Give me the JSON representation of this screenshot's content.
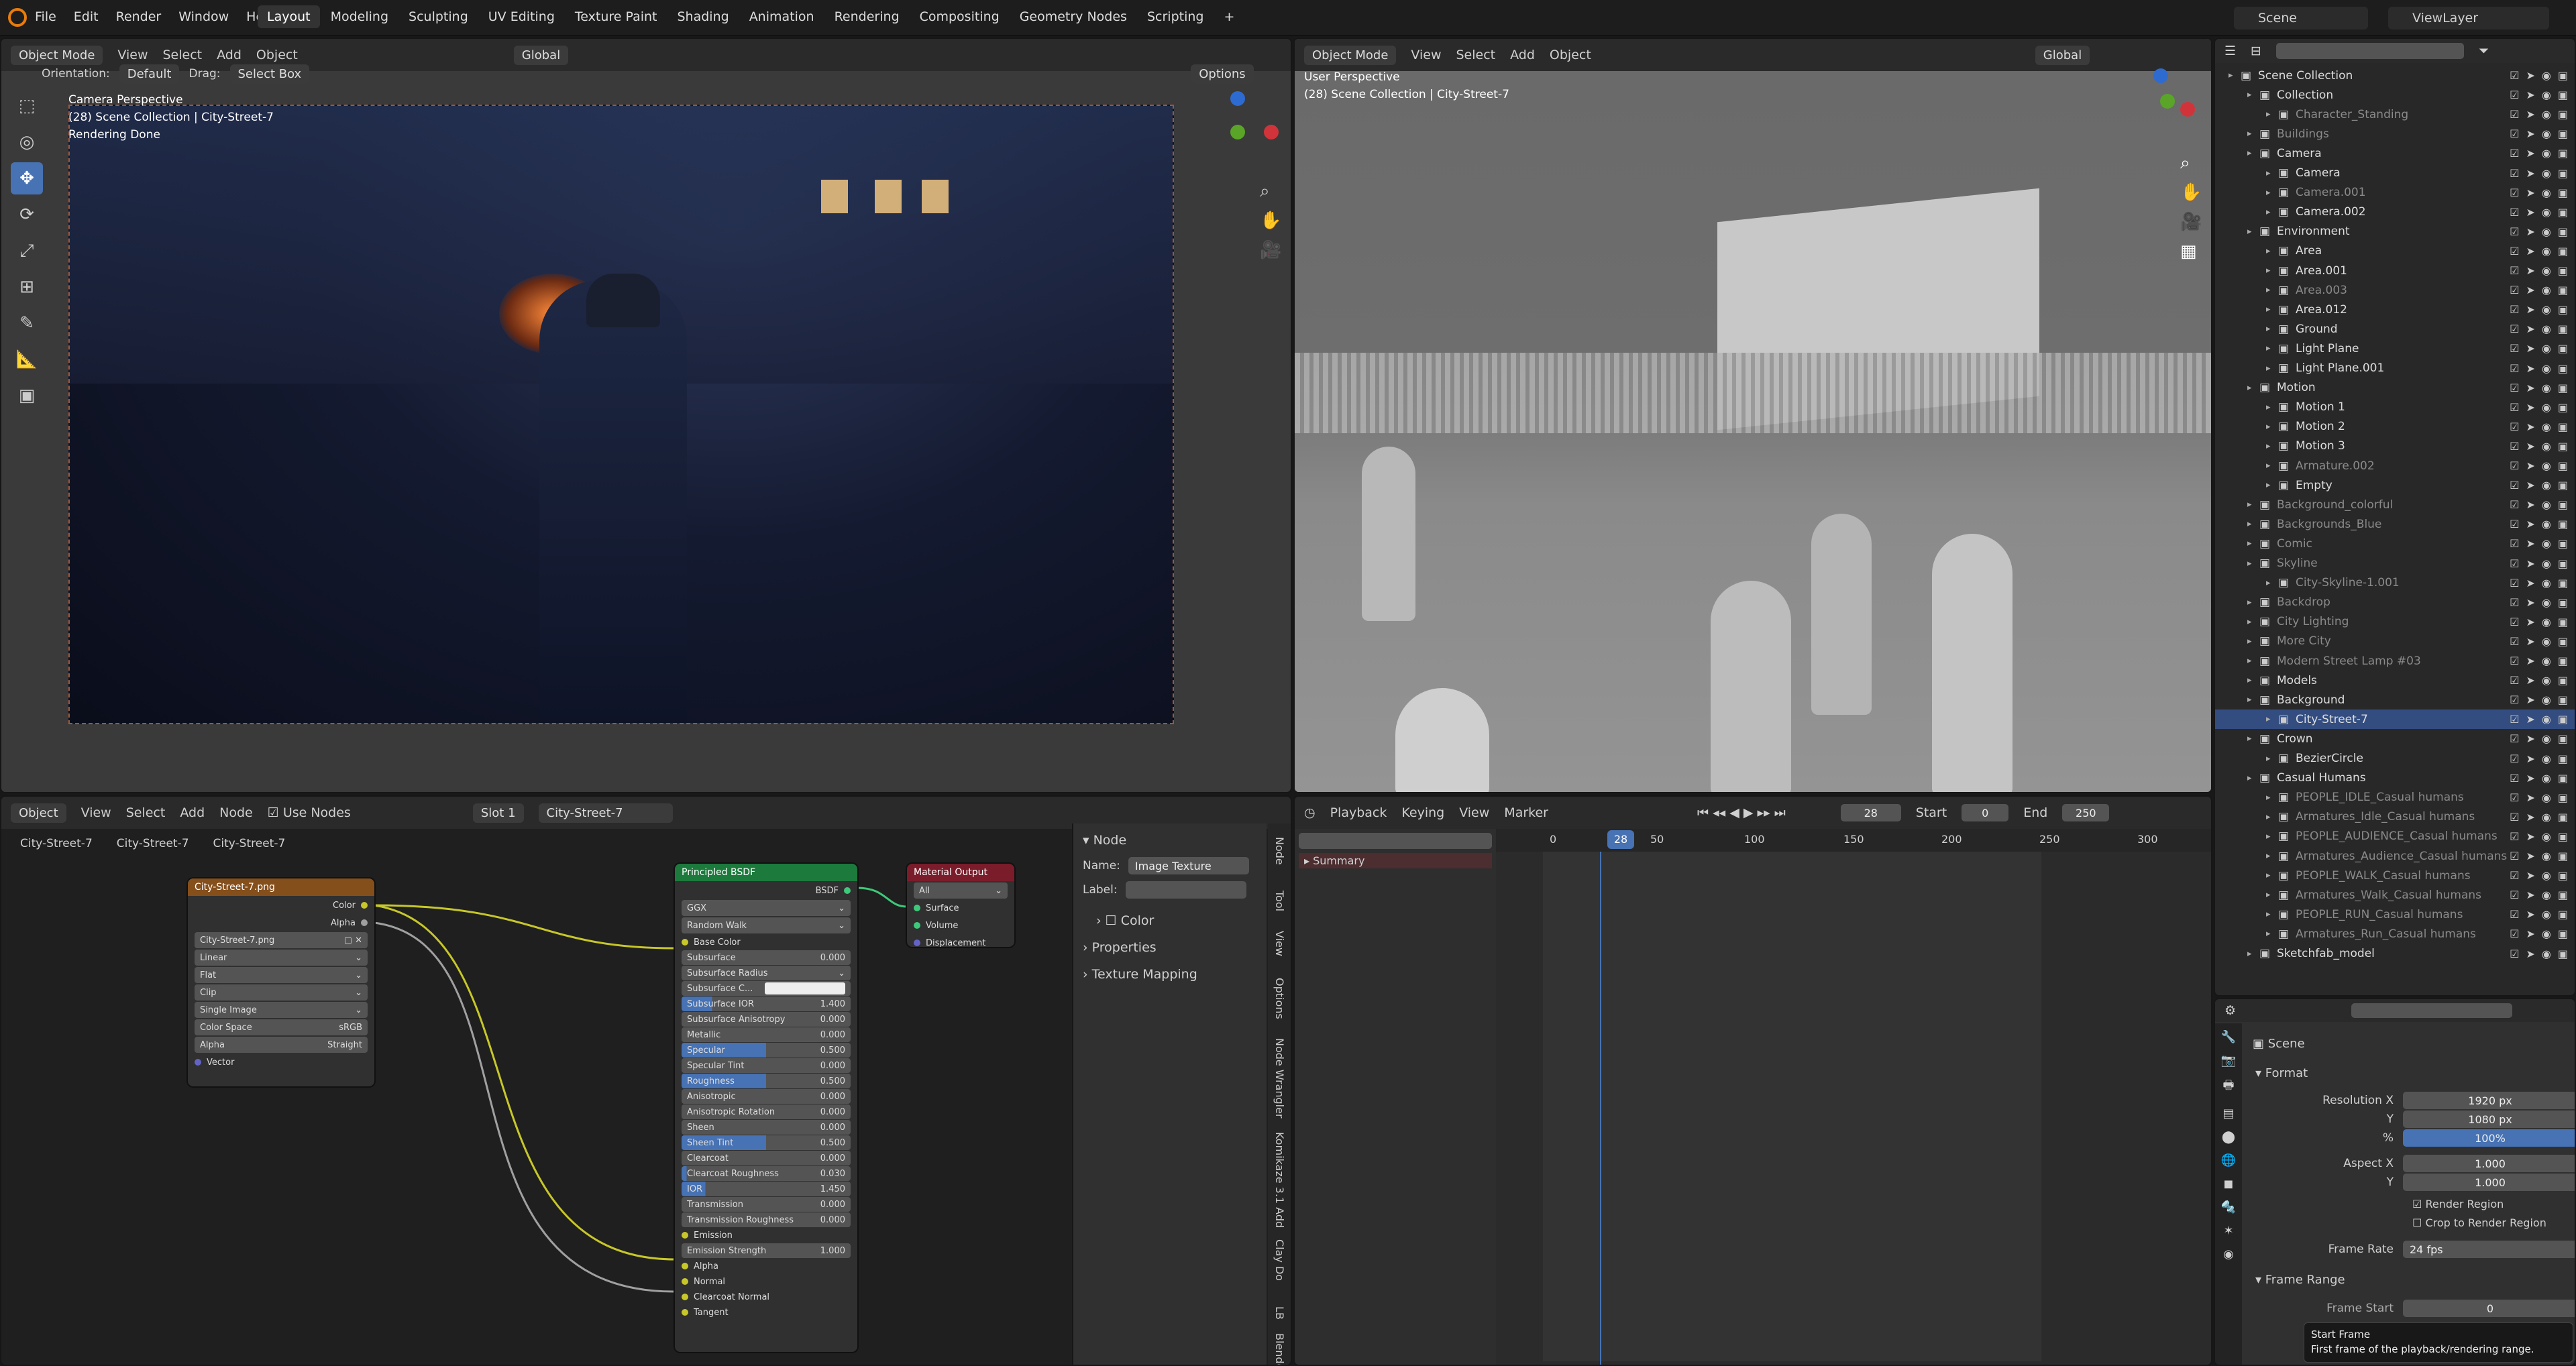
{
  "app": {
    "menus": [
      "File",
      "Edit",
      "Render",
      "Window",
      "Help"
    ],
    "workspaces": [
      "Layout",
      "Modeling",
      "Sculpting",
      "UV Editing",
      "Texture Paint",
      "Shading",
      "Animation",
      "Rendering",
      "Compositing",
      "Geometry Nodes",
      "Scripting"
    ],
    "active_workspace": "Layout",
    "scene": "Scene",
    "view_layer": "ViewLayer"
  },
  "viewport_left": {
    "mode": "Object Mode",
    "menus": [
      "View",
      "Select",
      "Add",
      "Object"
    ],
    "orientation_label": "Orientation:",
    "orientation": "Default",
    "drag_label": "Drag:",
    "drag": "Select Box",
    "transform": "Global",
    "options": "Options",
    "overlay_line1": "Camera Perspective",
    "overlay_line2": "(28) Scene Collection | City-Street-7",
    "overlay_line3": "Rendering Done"
  },
  "viewport_right": {
    "mode": "Object Mode",
    "menus": [
      "View",
      "Select",
      "Add",
      "Object"
    ],
    "transform": "Global",
    "overlay_line1": "User Perspective",
    "overlay_line2": "(28) Scene Collection | City-Street-7"
  },
  "node_editor": {
    "editor": "Object",
    "menus": [
      "View",
      "Select",
      "Add",
      "Node"
    ],
    "use_nodes": "Use Nodes",
    "slot": "Slot 1",
    "material": "City-Street-7",
    "breadcrumb": [
      "City-Street-7",
      "City-Street-7",
      "City-Street-7"
    ],
    "image_node": {
      "title": "City-Street-7.png",
      "out_color": "Color",
      "out_alpha": "Alpha",
      "image": "City-Street-7.png",
      "interpolation": "Linear",
      "projection": "Flat",
      "extension": "Clip",
      "source": "Single Image",
      "color_space_label": "Color Space",
      "color_space": "sRGB",
      "alpha_label": "Alpha",
      "alpha": "Straight",
      "vector": "Vector"
    },
    "bsdf": {
      "title": "Principled BSDF",
      "out": "BSDF",
      "distribution": "GGX",
      "sss_method": "Random Walk",
      "rows": [
        {
          "label": "Base Color",
          "type": "sock"
        },
        {
          "label": "Subsurface",
          "value": "0.000",
          "f": 0
        },
        {
          "label": "Subsurface Radius",
          "type": "drop"
        },
        {
          "label": "Subsurface C...",
          "type": "color"
        },
        {
          "label": "Subsurface IOR",
          "value": "1.400",
          "f": 18
        },
        {
          "label": "Subsurface Anisotropy",
          "value": "0.000",
          "f": 0
        },
        {
          "label": "Metallic",
          "value": "0.000",
          "f": 0
        },
        {
          "label": "Specular",
          "value": "0.500",
          "f": 50
        },
        {
          "label": "Specular Tint",
          "value": "0.000",
          "f": 0
        },
        {
          "label": "Roughness",
          "value": "0.500",
          "f": 50
        },
        {
          "label": "Anisotropic",
          "value": "0.000",
          "f": 0
        },
        {
          "label": "Anisotropic Rotation",
          "value": "0.000",
          "f": 0
        },
        {
          "label": "Sheen",
          "value": "0.000",
          "f": 0
        },
        {
          "label": "Sheen Tint",
          "value": "0.500",
          "f": 50
        },
        {
          "label": "Clearcoat",
          "value": "0.000",
          "f": 0
        },
        {
          "label": "Clearcoat Roughness",
          "value": "0.030",
          "f": 3
        },
        {
          "label": "IOR",
          "value": "1.450",
          "f": 14
        },
        {
          "label": "Transmission",
          "value": "0.000",
          "f": 0
        },
        {
          "label": "Transmission Roughness",
          "value": "0.000",
          "f": 0
        },
        {
          "label": "Emission",
          "type": "sock"
        },
        {
          "label": "Emission Strength",
          "value": "1.000",
          "f": 0
        },
        {
          "label": "Alpha",
          "type": "sock"
        },
        {
          "label": "Normal",
          "type": "sock"
        },
        {
          "label": "Clearcoat Normal",
          "type": "sock"
        },
        {
          "label": "Tangent",
          "type": "sock"
        }
      ]
    },
    "output": {
      "title": "Material Output",
      "target": "All",
      "inputs": [
        "Surface",
        "Volume",
        "Displacement"
      ]
    },
    "sidebar": {
      "section": "Node",
      "name_label": "Name:",
      "name": "Image Texture",
      "label_label": "Label:",
      "color": "Color",
      "properties": "Properties",
      "texture_mapping": "Texture Mapping"
    },
    "tabs": [
      "Node",
      "Tool",
      "View",
      "Options",
      "Node Wrangler",
      "Komikaze 3.1 Add",
      "Clay Do",
      "LB",
      "Blenderk"
    ]
  },
  "timeline": {
    "menus": [
      "Playback",
      "Keying",
      "View",
      "Marker"
    ],
    "current": "28",
    "start_label": "Start",
    "start": "0",
    "end_label": "End",
    "end": "250",
    "ticks": [
      "0",
      "50",
      "100",
      "150",
      "200",
      "250",
      "300"
    ],
    "frame_marker": "28",
    "summary": "Summary"
  },
  "outliner": {
    "rows": [
      {
        "label": "Scene Collection",
        "depth": 0,
        "dim": false
      },
      {
        "label": "Collection",
        "depth": 1
      },
      {
        "label": "Character_Standing",
        "depth": 2,
        "dim": true
      },
      {
        "label": "Buildings",
        "depth": 1,
        "dim": true
      },
      {
        "label": "Camera",
        "depth": 1
      },
      {
        "label": "Camera",
        "depth": 2
      },
      {
        "label": "Camera.001",
        "depth": 2,
        "dim": true
      },
      {
        "label": "Camera.002",
        "depth": 2
      },
      {
        "label": "Environment",
        "depth": 1
      },
      {
        "label": "Area",
        "depth": 2
      },
      {
        "label": "Area.001",
        "depth": 2
      },
      {
        "label": "Area.003",
        "depth": 2,
        "dim": true
      },
      {
        "label": "Area.012",
        "depth": 2
      },
      {
        "label": "Ground",
        "depth": 2
      },
      {
        "label": "Light Plane",
        "depth": 2
      },
      {
        "label": "Light Plane.001",
        "depth": 2
      },
      {
        "label": "Motion",
        "depth": 1
      },
      {
        "label": "Motion 1",
        "depth": 2
      },
      {
        "label": "Motion 2",
        "depth": 2
      },
      {
        "label": "Motion 3",
        "depth": 2
      },
      {
        "label": "Armature.002",
        "depth": 2,
        "dim": true
      },
      {
        "label": "Empty",
        "depth": 2
      },
      {
        "label": "Background_colorful",
        "depth": 1,
        "dim": true
      },
      {
        "label": "Backgrounds_Blue",
        "depth": 1,
        "dim": true
      },
      {
        "label": "Comic",
        "depth": 1,
        "dim": true
      },
      {
        "label": "Skyline",
        "depth": 1,
        "dim": true
      },
      {
        "label": "City-Skyline-1.001",
        "depth": 2,
        "dim": true
      },
      {
        "label": "Backdrop",
        "depth": 1,
        "dim": true
      },
      {
        "label": "City Lighting",
        "depth": 1,
        "dim": true
      },
      {
        "label": "More City",
        "depth": 1,
        "dim": true
      },
      {
        "label": "Modern Street Lamp #03",
        "depth": 1,
        "dim": true
      },
      {
        "label": "Models",
        "depth": 1
      },
      {
        "label": "Background",
        "depth": 1
      },
      {
        "label": "City-Street-7",
        "depth": 2,
        "sel": true
      },
      {
        "label": "Crown",
        "depth": 1
      },
      {
        "label": "BezierCircle",
        "depth": 2
      },
      {
        "label": "Casual Humans",
        "depth": 1
      },
      {
        "label": "PEOPLE_IDLE_Casual humans",
        "depth": 2,
        "dim": true
      },
      {
        "label": "Armatures_Idle_Casual humans",
        "depth": 2,
        "dim": true
      },
      {
        "label": "PEOPLE_AUDIENCE_Casual humans",
        "depth": 2,
        "dim": true
      },
      {
        "label": "Armatures_Audience_Casual humans",
        "depth": 2,
        "dim": true
      },
      {
        "label": "PEOPLE_WALK_Casual humans",
        "depth": 2,
        "dim": true
      },
      {
        "label": "Armatures_Walk_Casual humans",
        "depth": 2,
        "dim": true
      },
      {
        "label": "PEOPLE_RUN_Casual humans",
        "depth": 2,
        "dim": true
      },
      {
        "label": "Armatures_Run_Casual humans",
        "depth": 2,
        "dim": true
      },
      {
        "label": "Sketchfab_model",
        "depth": 1
      }
    ]
  },
  "properties": {
    "scene": "Scene",
    "format": "Format",
    "res_x_label": "Resolution X",
    "res_x": "1920 px",
    "res_y_label": "Y",
    "res_y": "1080 px",
    "pct_label": "%",
    "pct": "100%",
    "aspect_x_label": "Aspect X",
    "aspect_x": "1.000",
    "aspect_y_label": "Y",
    "aspect_y": "1.000",
    "render_region": "Render Region",
    "crop": "Crop to Render Region",
    "frame_rate_label": "Frame Rate",
    "frame_rate": "24 fps",
    "frame_range": "Frame Range",
    "frame_start_label": "Frame Start",
    "frame_start": "0",
    "tooltip_title": "Start Frame",
    "tooltip_body": "First frame of the playback/rendering range."
  }
}
